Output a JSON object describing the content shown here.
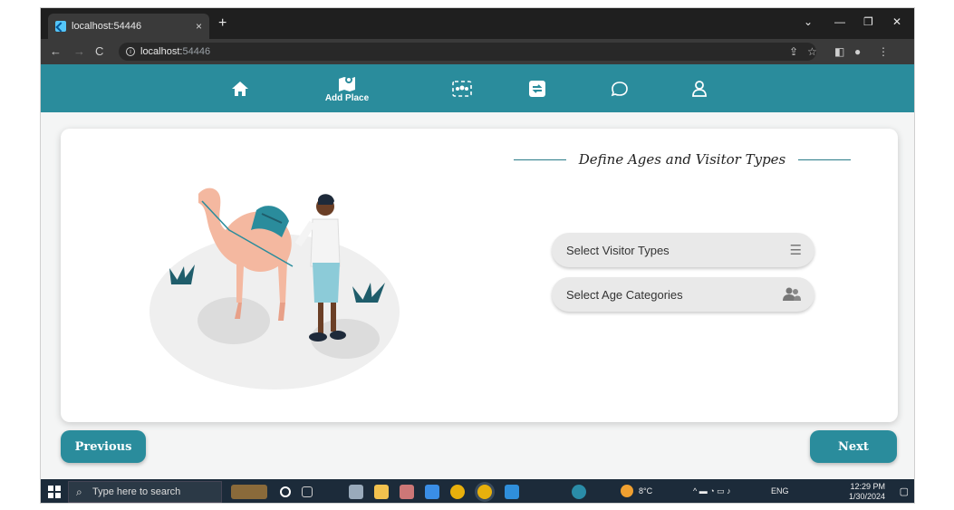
{
  "browser": {
    "tab_title": "localhost:54446",
    "tab_close": "×",
    "new_tab": "+",
    "url_host": "localhost:",
    "url_port": "54446"
  },
  "app_nav": {
    "items": [
      {
        "icon": "home-icon",
        "label": ""
      },
      {
        "icon": "map-pin-icon",
        "label": "Add Place"
      },
      {
        "icon": "group-icon",
        "label": ""
      },
      {
        "icon": "swap-icon",
        "label": ""
      },
      {
        "icon": "chat-icon",
        "label": ""
      },
      {
        "icon": "user-icon",
        "label": ""
      }
    ]
  },
  "main": {
    "heading": "Define Ages and Visitor Types",
    "visitor_select": "Select Visitor Types",
    "age_select": "Select Age Categories"
  },
  "buttons": {
    "previous": "Previous",
    "next": "Next"
  },
  "taskbar": {
    "search_placeholder": "Type here to search",
    "weather": "8°C",
    "language": "ENG",
    "time": "12:29 PM",
    "date": "1/30/2024"
  },
  "colors": {
    "accent": "#2a8c9c",
    "nav_bg": "#2a8c9c",
    "camel": "#f4b8a0"
  }
}
